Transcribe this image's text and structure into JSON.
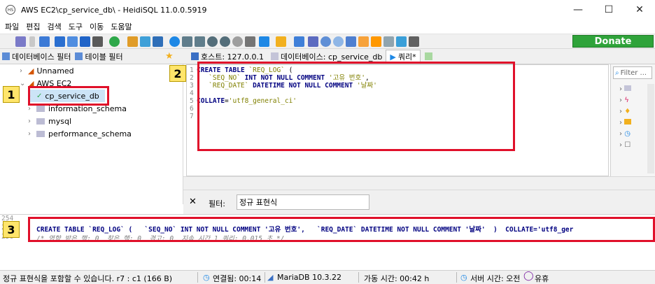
{
  "window": {
    "title": "AWS EC2\\cp_service_db\\ - HeidiSQL 11.0.0.5919",
    "app_icon": "HS",
    "minimize": "—",
    "maximize": "☐",
    "close": "✕"
  },
  "menu": [
    "파일",
    "편집",
    "검색",
    "도구",
    "이동",
    "도움말"
  ],
  "toolbar": {
    "donate_label": "Donate"
  },
  "left_tabs": {
    "db_filter": "데이터베이스 필터",
    "table_filter": "테이블 필터"
  },
  "right_tabs": {
    "host": "호스트: 127.0.0.1",
    "database": "데이터베이스: cp_service_db",
    "query": "쿼리*"
  },
  "tree": {
    "unnamed": "Unnamed",
    "aws": "AWS EC2",
    "dbs": [
      "cp_service_db",
      "information_schema",
      "mysql",
      "performance_schema"
    ]
  },
  "editor": {
    "lines": [
      {
        "n": "1",
        "t": "CREATE TABLE `REQ_LOG` ("
      },
      {
        "n": "2",
        "t": "   `SEQ_NO` INT NOT NULL COMMENT '고유 번호',"
      },
      {
        "n": "3",
        "t": "   `REQ_DATE` DATETIME NOT NULL COMMENT '날짜'"
      },
      {
        "n": "4",
        "t": ")"
      },
      {
        "n": "5",
        "t": "COLLATE='utf8_general_ci'"
      },
      {
        "n": "6",
        "t": ";"
      },
      {
        "n": "7",
        "t": ""
      }
    ]
  },
  "filter_panel": {
    "placeholder": "Filter ..."
  },
  "filter_row": {
    "close": "✕",
    "label": "필터:",
    "value": "정규 표현식"
  },
  "log": {
    "line_numbers": [
      "254",
      "255",
      "256"
    ],
    "line1": "CREATE TABLE `REQ_LOG` (   `SEQ_NO` INT NOT NULL COMMENT '고유 번호',   `REQ_DATE` DATETIME NOT NULL COMMENT '날짜'  )  COLLATE='utf8_ger",
    "line2": "/* 영향 받은 행: 0  찾은 행: 0  경고: 0  지속 시간 1 쿼리: 0.015 초 */"
  },
  "status": {
    "msg": "정규 표현식을 포함할 수 있습니다. r7 : c1 (166 B)",
    "connected": "연결됨: 00:14",
    "server": "MariaDB 10.3.22",
    "uptime": "가동 시간: 00:42 h",
    "server_time": "서버 시간: 오전",
    "idle": "유휴"
  },
  "badges": [
    "1",
    "2",
    "3"
  ],
  "colors": {
    "highlight_red": "#e0102a",
    "badge_yellow": "#ffe56b",
    "donate_green": "#2fa33a",
    "keyword_navy": "#000080",
    "string_olive": "#808000"
  }
}
